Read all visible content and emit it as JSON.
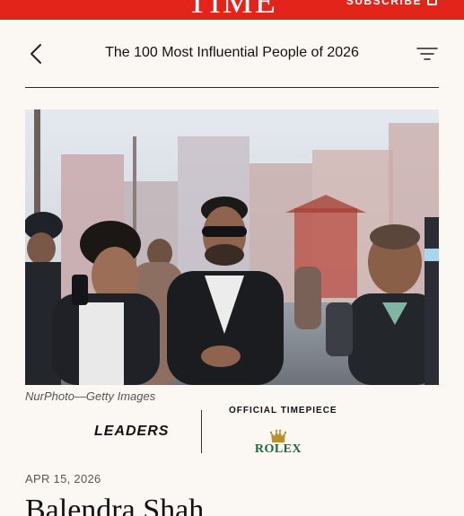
{
  "header": {
    "logo": "TIME",
    "subscribe_label": "SUBSCRIBE",
    "brand_color": "#e3241b"
  },
  "nav": {
    "title": "The 100 Most Influential People of 2026",
    "back_icon": "chevron-left-icon",
    "menu_icon": "filter-menu-icon"
  },
  "article": {
    "photo_alt": "Man in sunglasses and black blazer walking on a street, surrounded by people",
    "photo_credit": "NurPhoto—Getty Images",
    "category": "LEADERS",
    "sponsor_label": "OFFICIAL TIMEPIECE",
    "sponsor_name": "ROLEX",
    "sponsor_color": "#1a6b3a",
    "date": "APR 15, 2026",
    "headline": "Balendra Shah"
  }
}
